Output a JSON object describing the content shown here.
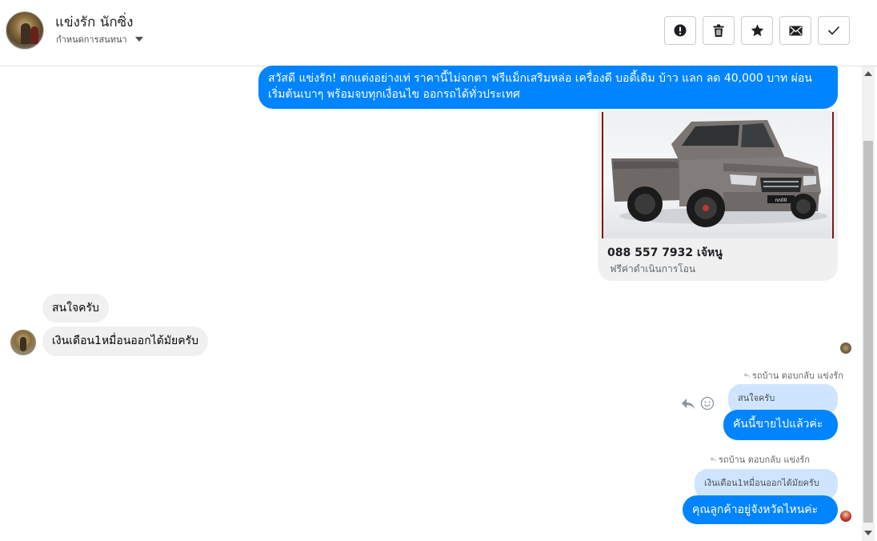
{
  "header": {
    "contact_name": "แข่งรัก นักซิ่ง",
    "subtitle": "กำหนดการสนทนา",
    "buttons": {
      "report": "exclamation-circle-icon",
      "delete": "trash-icon",
      "star": "star-icon",
      "mark_unread": "envelope-icon",
      "done": "checkmark-icon"
    }
  },
  "messages": {
    "outgoing_intro": "สวัสดี แข่งรัก! ตกแต่งอย่างเท่ ราคานี้ไม่จกตา ฟรีแม็กเสริมหล่อ เครื่องดี บอดี้เดิม บ้าว แลก ลด 40,000 บาท ผ่อนเริ่มต้นเบาๆ พร้อมจบทุกเงื่อนไข ออกรถได้ทั่วประเทศ",
    "card": {
      "title": "088 557 7932 เจ้หนู",
      "subtitle": "ฟรีค่าดำเนินการโอน",
      "plate": "กก00"
    },
    "incoming": [
      {
        "text": "สนใจครับ"
      },
      {
        "text": "เงินเดือน1หมื่อนออกได้มัยครับ"
      }
    ],
    "replies": [
      {
        "label": "รถบ้าน ตอบกลับ แข่งรัก",
        "quoted": "สนใจครับ",
        "text": "คันนี้ขายไปแล้วค่ะ"
      },
      {
        "label": "รถบ้าน ตอบกลับ แข่งรัก",
        "quoted": "เงินเดือน1หมื่อนออกได้มัยครับ",
        "text": "คุณลูกค้าอยู่จังหวัดไหนค่ะ"
      }
    ]
  },
  "colors": {
    "outgoing_bubble": "#0084ff",
    "incoming_bubble": "#f0f0f0",
    "quoted_bubble": "#cfe5ff"
  }
}
